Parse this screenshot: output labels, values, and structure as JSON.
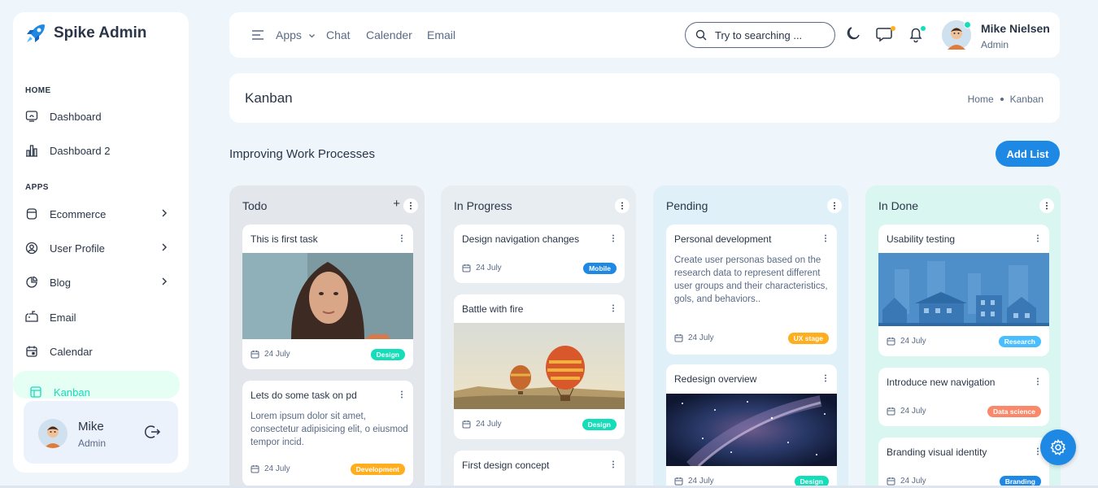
{
  "app": {
    "name": "Spike Admin",
    "accent": "#1e88e5"
  },
  "sidebar": {
    "sections": [
      "HOME",
      "APPS"
    ],
    "items": [
      {
        "label": "Dashboard",
        "icon": "dashboard-icon"
      },
      {
        "label": "Dashboard 2",
        "icon": "chart-icon"
      },
      {
        "label": "Ecommerce",
        "icon": "basket-icon"
      },
      {
        "label": "User Profile",
        "icon": "user-circle-icon"
      },
      {
        "label": "Blog",
        "icon": "pie-icon"
      },
      {
        "label": "Email",
        "icon": "mailbox-icon"
      },
      {
        "label": "Calendar",
        "icon": "calendar-icon"
      },
      {
        "label": "Kanban",
        "icon": "kanban-icon",
        "active": true
      }
    ],
    "profile": {
      "name": "Mike",
      "role": "Admin"
    }
  },
  "topbar": {
    "nav": [
      "Apps",
      "Chat",
      "Calender",
      "Email"
    ],
    "search_placeholder": "Try to searching ...",
    "user": {
      "name": "Mike Nielsen",
      "role": "Admin"
    }
  },
  "page": {
    "title": "Kanban",
    "breadcrumb": [
      "Home",
      "Kanban"
    ],
    "board_title": "Improving Work Processes",
    "add_list_label": "Add List"
  },
  "columns": [
    {
      "title": "Todo",
      "bg": "#e3e7ec",
      "cards": [
        {
          "title": "This is first task",
          "date": "24 July",
          "badge": "Design",
          "badge_color": "#13deb9"
        },
        {
          "title": "Lets do some task on pd",
          "desc": "Lorem ipsum dolor sit amet, consectetur adipisicing elit, o eiusmod tempor incid.",
          "date": "24 July",
          "badge": "Development",
          "badge_color": "#ffae1f"
        }
      ]
    },
    {
      "title": "In Progress",
      "bg": "#e8edf2",
      "cards": [
        {
          "title": "Design navigation changes",
          "date": "24 July",
          "badge": "Mobile",
          "badge_color": "#1e88e5"
        },
        {
          "title": "Battle with fire",
          "date": "24 July",
          "badge": "Design",
          "badge_color": "#13deb9"
        },
        {
          "title": "First design concept"
        }
      ]
    },
    {
      "title": "Pending",
      "bg": "#dff0f9",
      "cards": [
        {
          "title": "Personal development",
          "desc": "Create user personas based on the research data to represent different user groups and their characteristics, gols, and behaviors..",
          "date": "24 July",
          "badge": "UX stage",
          "badge_color": "#ffae1f"
        },
        {
          "title": "Redesign overview",
          "date": "24 July",
          "badge": "Design",
          "badge_color": "#13deb9"
        }
      ]
    },
    {
      "title": "In Done",
      "bg": "#d9f6f0",
      "cards": [
        {
          "title": "Usability testing",
          "date": "24 July",
          "badge": "Research",
          "badge_color": "#49beff"
        },
        {
          "title": "Introduce new navigation",
          "date": "24 July",
          "badge": "Data science",
          "badge_color": "#fa896b"
        },
        {
          "title": "Branding visual identity",
          "date": "24 July",
          "badge": "Branding",
          "badge_color": "#1e88e5"
        }
      ]
    }
  ]
}
